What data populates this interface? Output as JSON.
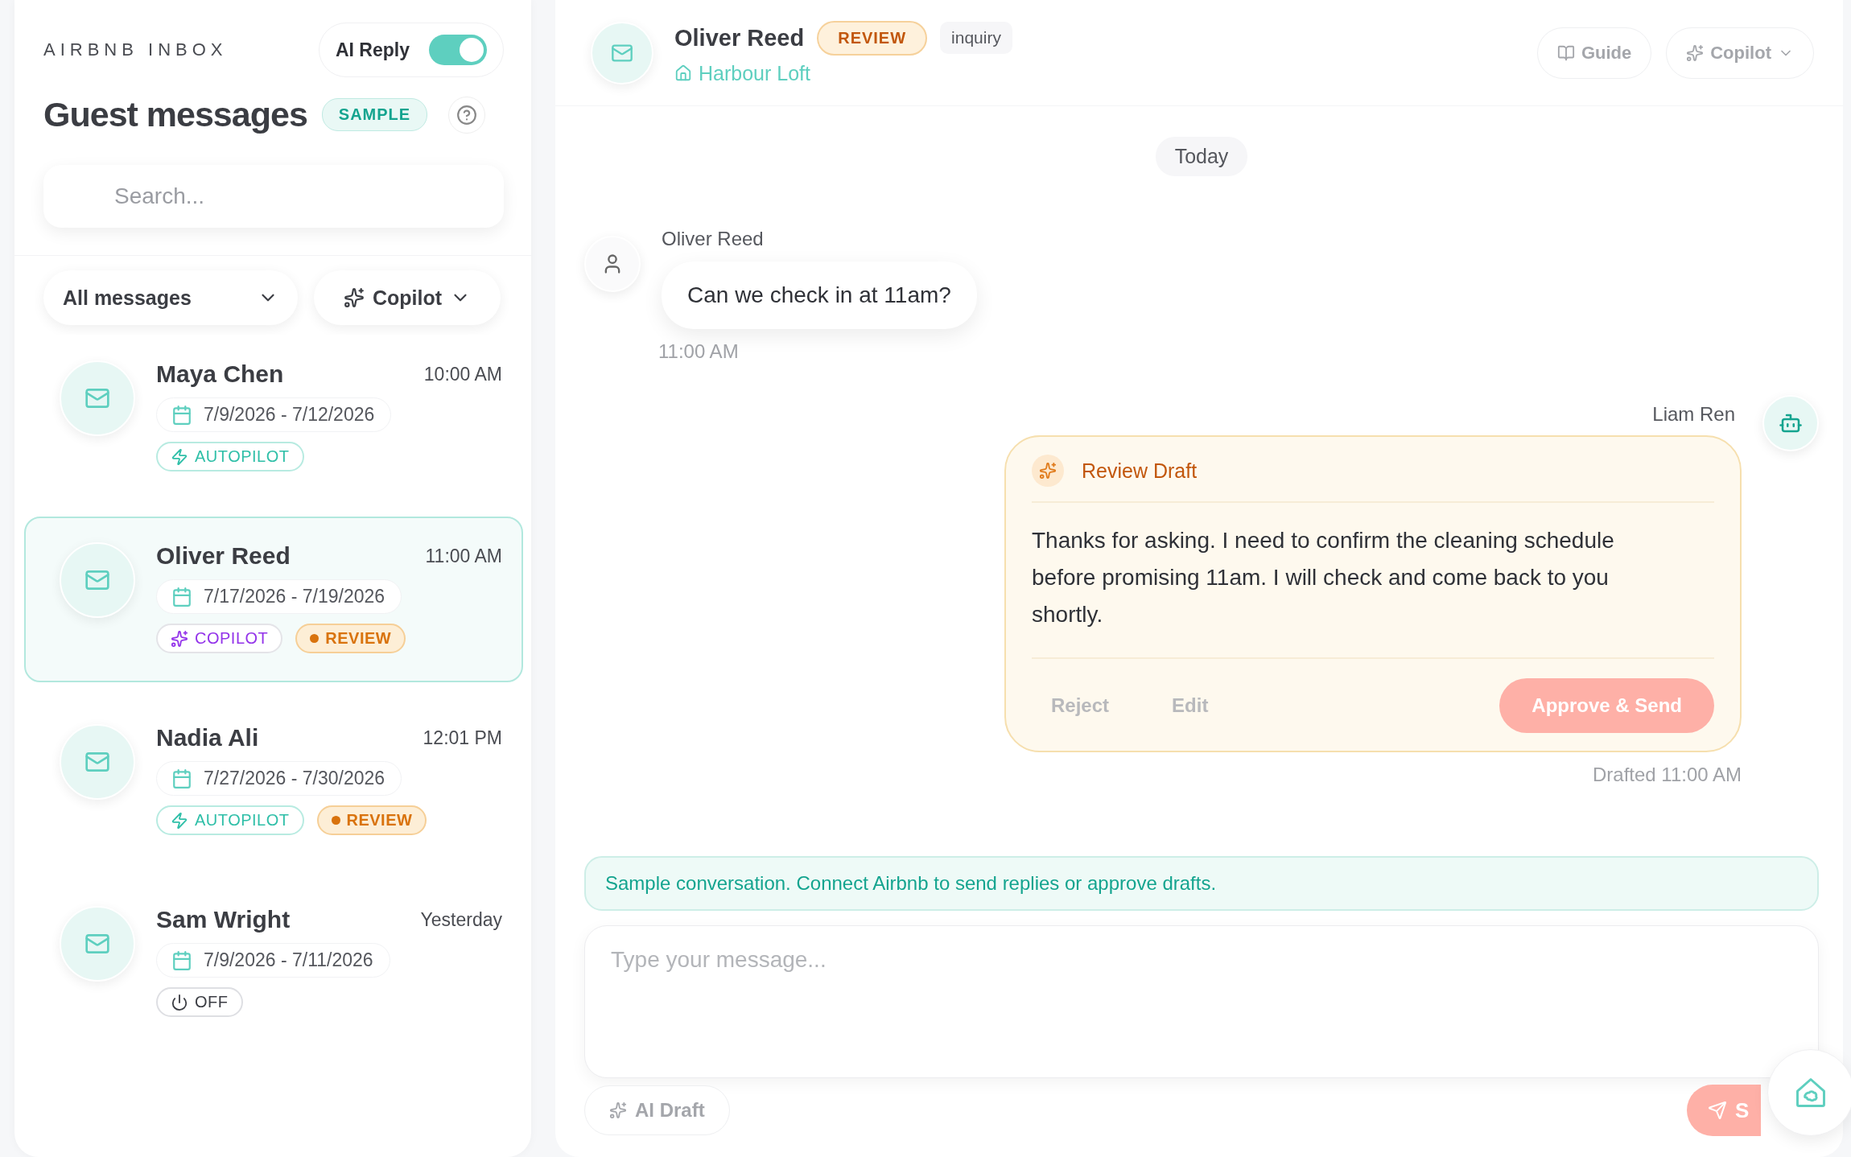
{
  "sidebar": {
    "brand": "AIRBNB INBOX",
    "ai_reply": {
      "label": "AI Reply",
      "on": true
    },
    "title": "Guest messages",
    "badge": "SAMPLE",
    "search": {
      "placeholder": "Search..."
    },
    "filters": [
      {
        "label": "All messages",
        "kind": "plain"
      },
      {
        "label": "Copilot",
        "kind": "copilot"
      }
    ],
    "conversations": [
      {
        "name": "Maya Chen",
        "time": "10:00 AM",
        "dates": "7/9/2026 - 7/12/2026",
        "selected": false,
        "tags": [
          {
            "label": "AUTOPILOT",
            "kind": "autopilot"
          }
        ]
      },
      {
        "name": "Oliver Reed",
        "time": "11:00 AM",
        "dates": "7/17/2026 - 7/19/2026",
        "selected": true,
        "tags": [
          {
            "label": "COPILOT",
            "kind": "copilot"
          },
          {
            "label": "REVIEW",
            "kind": "review"
          }
        ]
      },
      {
        "name": "Nadia Ali",
        "time": "12:01 PM",
        "dates": "7/27/2026 - 7/30/2026",
        "selected": false,
        "tags": [
          {
            "label": "AUTOPILOT",
            "kind": "autopilot"
          },
          {
            "label": "REVIEW",
            "kind": "review"
          }
        ]
      },
      {
        "name": "Sam Wright",
        "time": "Yesterday",
        "dates": "7/9/2026 - 7/11/2026",
        "selected": false,
        "tags": [
          {
            "label": "OFF",
            "kind": "off"
          }
        ]
      }
    ]
  },
  "conversation": {
    "guest": "Oliver Reed",
    "status": "REVIEW",
    "type": "inquiry",
    "listing": "Harbour Loft",
    "actions": [
      {
        "label": "Guide",
        "kind": "guide"
      },
      {
        "label": "Copilot",
        "kind": "copilot"
      }
    ],
    "day": "Today",
    "messages": [
      {
        "kind": "guest",
        "sender": "Oliver Reed",
        "text": "Can we check in at 11am?",
        "time": "11:00 AM"
      },
      {
        "kind": "draft",
        "sender": "Liam Ren",
        "title": "Review Draft",
        "text": "Thanks for asking. I need to confirm the cleaning schedule before promising 11am. I will check and come back to you shortly.",
        "buttons": [
          "Reject",
          "Edit"
        ],
        "approve": "Approve & Send",
        "time": "Drafted 11:00 AM"
      }
    ]
  },
  "notice": "Sample conversation. Connect Airbnb to send replies or approve drafts.",
  "composer": {
    "placeholder": "Type your message...",
    "ai_draft": "AI Draft",
    "send": "S"
  }
}
